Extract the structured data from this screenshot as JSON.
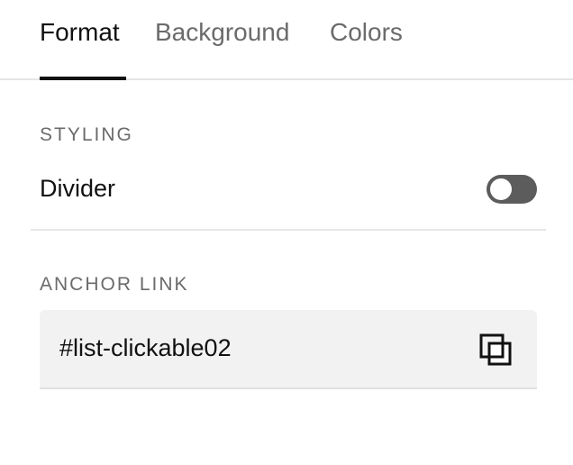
{
  "tabs": [
    {
      "label": "Format",
      "active": true
    },
    {
      "label": "Background",
      "active": false
    },
    {
      "label": "Colors",
      "active": false
    }
  ],
  "styling": {
    "section_label": "STYLING",
    "divider_label": "Divider",
    "divider_enabled": false
  },
  "anchor": {
    "section_label": "ANCHOR LINK",
    "value": "#list-clickable02",
    "copy_icon": "copy-icon"
  },
  "colors": {
    "text": "#111111",
    "muted": "#6b6b6b",
    "toggle_off": "#5c5c5c",
    "field_bg": "#f2f2f2"
  }
}
